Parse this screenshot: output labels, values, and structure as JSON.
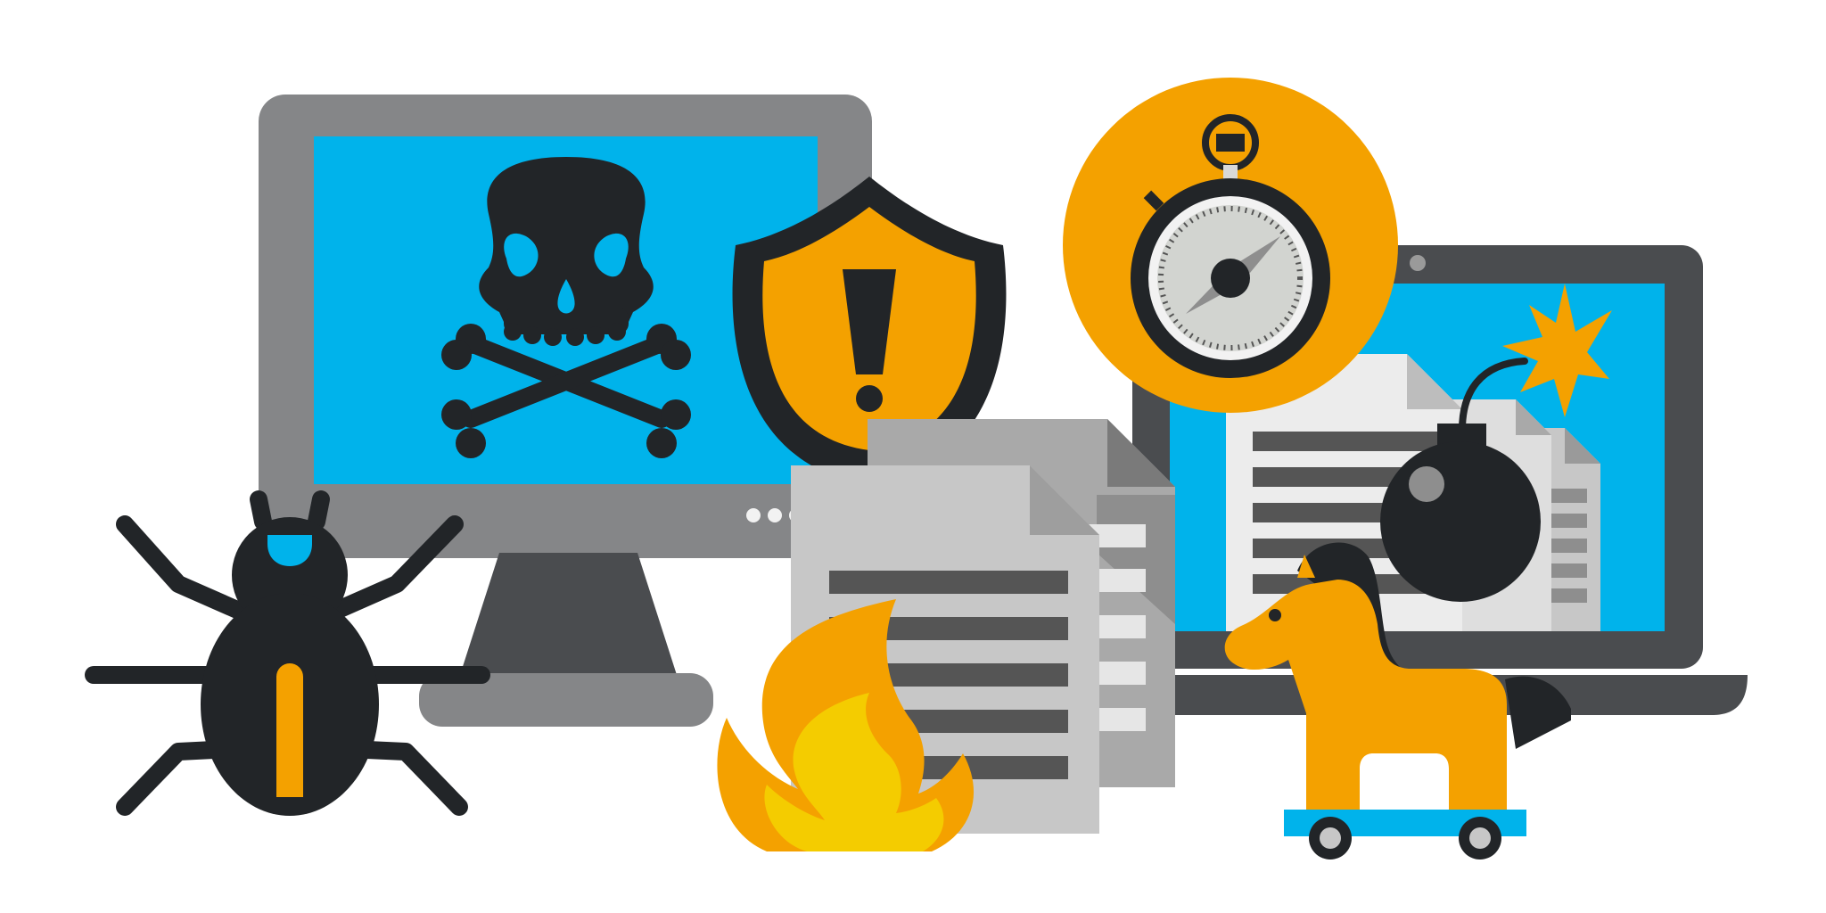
{
  "illustration": {
    "icons": [
      "desktop-monitor-icon",
      "skull-crossbones-icon",
      "shield-warning-icon",
      "stopwatch-icon",
      "laptop-icon",
      "document-stack-icon",
      "fire-icon",
      "bomb-icon",
      "trojan-horse-icon",
      "bug-icon"
    ]
  },
  "colors": {
    "background": "#ffffff",
    "screen_blue": "#00b3eb",
    "orange": "#f4a100",
    "yellow": "#f4cc00",
    "dark": "#222528",
    "monitor_gray": "#858688",
    "laptop_dark": "#4a4c4f",
    "paper_light": "#c7c7c7",
    "paper_mid": "#a9a9a9",
    "paper_white": "#ececec",
    "line_dark": "#555555"
  }
}
